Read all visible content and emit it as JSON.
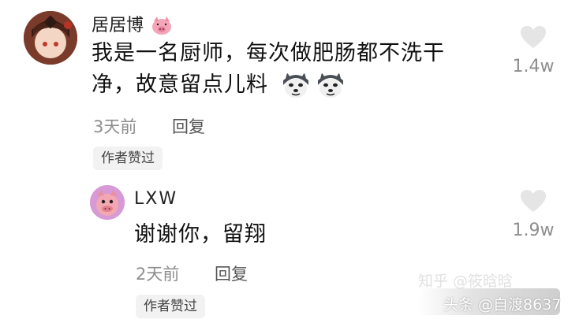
{
  "comment": {
    "username": "居居博",
    "text_line1": "我是一名厨师，每次做肥肠都不洗干",
    "text_line2": "净，故意留点儿料",
    "time": "3天前",
    "reply_label": "回复",
    "badge": "作者赞过",
    "likes": "1.4w"
  },
  "reply": {
    "username": "LXW",
    "text": "谢谢你，留翔",
    "time": "2天前",
    "reply_label": "回复",
    "badge": "作者赞过",
    "likes": "1.9w"
  },
  "watermark": {
    "zhihu": "知乎 @筱晗晗",
    "toutiao": "头条 @自渡8637"
  },
  "icons": {
    "heart_color": "#e5e5e5",
    "badge_bg": "#f2f2f2",
    "meta_color": "#8e8e8e"
  }
}
